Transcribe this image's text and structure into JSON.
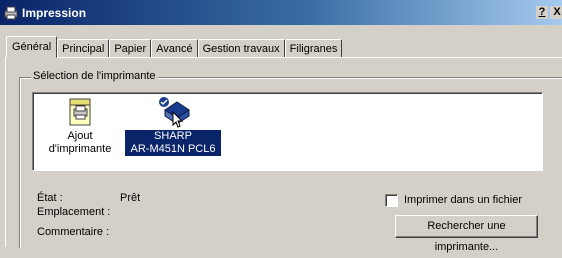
{
  "window": {
    "title": "Impression",
    "help_btn": "?",
    "close_btn": "X"
  },
  "tabs": [
    {
      "label": "Général",
      "active": true
    },
    {
      "label": "Principal"
    },
    {
      "label": "Papier"
    },
    {
      "label": "Avancé"
    },
    {
      "label": "Gestion travaux"
    },
    {
      "label": "Filigranes"
    }
  ],
  "printer_selection": {
    "group_label": "Sélection de l'imprimante",
    "items": [
      {
        "label_line1": "Ajout",
        "label_line2": "d'imprimante",
        "icon": "add-printer-icon"
      },
      {
        "label_line1": "SHARP",
        "label_line2": "AR-M451N PCL6",
        "icon": "printer-icon",
        "selected": true
      }
    ]
  },
  "status": {
    "state_label": "État :",
    "state_value": "Prêt",
    "location_label": "Emplacement :",
    "comment_label": "Commentaire :"
  },
  "options": {
    "print_to_file_label": "Imprimer dans un fichier",
    "print_to_file_checked": false,
    "find_printer_button": "Rechercher une imprimante..."
  }
}
